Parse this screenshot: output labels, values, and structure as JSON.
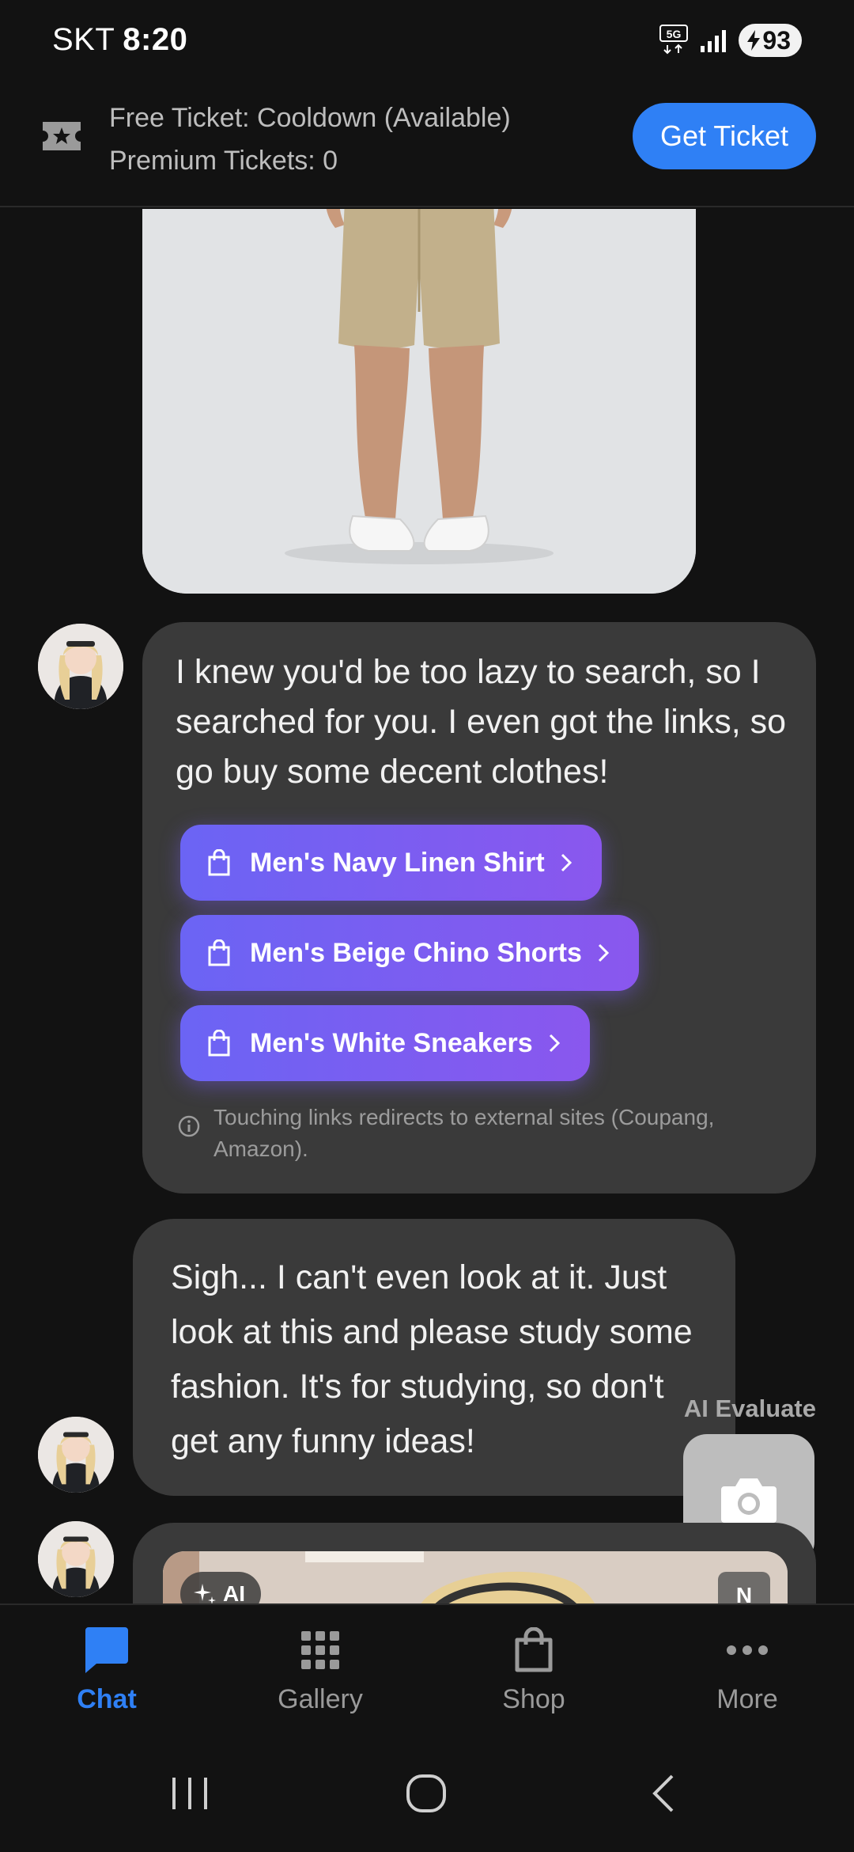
{
  "status_bar": {
    "carrier": "SKT",
    "time": "8:20",
    "network": "5G",
    "battery": "93"
  },
  "ticket": {
    "free_line": "Free Ticket: Cooldown (Available)",
    "premium_line": "Premium Tickets: 0",
    "button_label": "Get Ticket"
  },
  "messages": {
    "bot_message_1": {
      "text": "I knew you'd be too lazy to search, so I searched for you. I even got the links, so go buy some decent clothes!",
      "links": [
        {
          "label": "Men's Navy Linen Shirt"
        },
        {
          "label": "Men's Beige Chino Shorts"
        },
        {
          "label": "Men's White Sneakers"
        }
      ],
      "notice": "Touching links redirects to external sites (Coupang, Amazon)."
    },
    "bot_message_2": {
      "text": "Sigh... I can't even look at it. Just look at this and please study some fashion. It's for studying, so don't get any funny ideas!"
    },
    "image_badges": {
      "ai": "AI",
      "n": "N"
    }
  },
  "ai_evaluate": {
    "label": "AI Evaluate",
    "icon": "camera-icon"
  },
  "bottom_nav": {
    "items": [
      {
        "label": "Chat",
        "icon": "chat-icon",
        "active": true
      },
      {
        "label": "Gallery",
        "icon": "grid-icon",
        "active": false
      },
      {
        "label": "Shop",
        "icon": "shopping-bag-icon",
        "active": false
      },
      {
        "label": "More",
        "icon": "more-icon",
        "active": false
      }
    ]
  },
  "colors": {
    "accent": "#2f80f5",
    "link_gradient_start": "#6b64f4",
    "link_gradient_end": "#8a57ee",
    "bubble": "#3a3a3a",
    "background": "#121212"
  }
}
